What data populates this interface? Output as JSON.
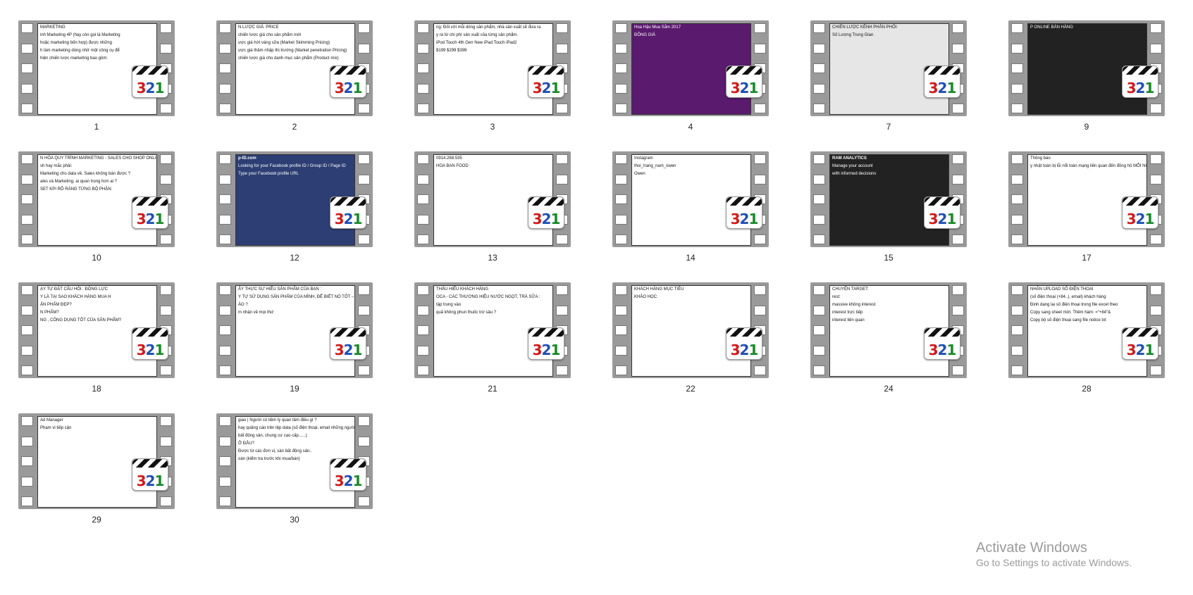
{
  "colors": {
    "film": "#9a9a9a",
    "badge_3": "#d21a1a",
    "badge_2": "#1f4fb8",
    "badge_1": "#1a8a2a"
  },
  "badge_icon": "mpc-321-icon",
  "thumbnails": [
    {
      "label": "1",
      "lines": [
        "MARKETING",
        "inh Marketing 4P (hay còn gọi là Marketing",
        "hoặc marketing bốn hợp) được những",
        "h làm marketing dùng nhử một công cụ để",
        "hiện chiến lược marketing bao gồm:"
      ],
      "style": "light"
    },
    {
      "label": "2",
      "lines": [
        "N LƯỢC GIÁ: PRICE",
        "chiến lược giá cho sản phẩm mới",
        "ược giá hớt váng sữa (Market Skimming Pricing)",
        "ược giá thâm nhập thị trường (Market penetration Pricing)",
        "chiến lược giá cho danh mục sản phẩm (Product mix)"
      ],
      "style": "light"
    },
    {
      "label": "3",
      "lines": [
        "ng: Đối với mỗi dòng sản phẩm, nhà sản xuất sẽ đưa ra",
        "y ra từ chi phí sản xuất của từng sản phẩm.",
        "iPod Touch  4th Gen  New iPad Touch  iPad2",
        "$199   $299   $399"
      ],
      "style": "light"
    },
    {
      "label": "4",
      "lines": [
        "Hoa Hậu Mua Sắm 2017",
        "ĐỒNG GIÁ"
      ],
      "style": "purple"
    },
    {
      "label": "7",
      "lines": [
        "CHIẾN LƯỢC KÊNH PHÂN PHỐI:",
        "Số Lượng Trung Gian"
      ],
      "style": "gray"
    },
    {
      "label": "9",
      "lines": [
        "P ONLINE BÁN HÀNG"
      ],
      "style": "photo"
    },
    {
      "label": "10",
      "lines": [
        "N HÓA QUY TRÌNH MARKETING - SALES CHO SHOP ONLINE",
        "sh hay mắc phải:",
        "Marketing cho data về. Sales không bán được ?",
        "ales và Marketing, ai quan trọng hơn ai ?",
        "SET KPI RÕ RÀNG TỪNG BỘ PHẬN:"
      ],
      "style": "light"
    },
    {
      "label": "12",
      "lines": [
        "p-ID.com",
        "Looking for your Facebook profile ID / Group ID / Page ID",
        "Type your Facebook profile URL"
      ],
      "style": "navy"
    },
    {
      "label": "13",
      "lines": [
        "0914.268.535",
        "HOA BAN FOOD"
      ],
      "style": "web"
    },
    {
      "label": "14",
      "lines": [
        "Instagram",
        "thoi_trang_nam_owen",
        "Owen"
      ],
      "style": "web"
    },
    {
      "label": "15",
      "lines": [
        "RAM ANALYTICS",
        "Manage your account",
        "with informed decisions"
      ],
      "style": "dark"
    },
    {
      "label": "17",
      "lines": [
        "Thông báo",
        "y nhật toán bị lỗi nổi toàn mạng liên quan đến đồng hồ MỖI NGÀY MỘT CÁCH"
      ],
      "style": "light"
    },
    {
      "label": "18",
      "lines": [
        "ẠY TỰ ĐẶT CÂU HỎI : ĐỘNG LỰC",
        "Y LÀ TẠI SAO KHÁCH HÀNG MUA H",
        "ẢN PHẨM ĐẸP?",
        "N PHẨM?",
        "NG , CÔNG DỤNG TỐT CỦA SẢN PHẨM?"
      ],
      "style": "light"
    },
    {
      "label": "19",
      "lines": [
        "ÂY THỰC SỰ HIỂU SẢN PHẨM CỦA BẠN :",
        "Y TỰ SỬ DỤNG SẢN PHẨM CỦA MÌNH, ĐỂ BIẾT NÓ TỐT – KÉM",
        "ÀO ?",
        "m nhận về mọi thứ:"
      ],
      "style": "light"
    },
    {
      "label": "21",
      "lines": [
        "THẤU HIỂU KHÁCH HÀNG",
        "OCA - CÁC THƯƠNG HIỆU NƯỚC NGỌT, TRÀ SỮA :",
        "tập trung vào",
        "quả không phun thuốc trừ sâu ?"
      ],
      "style": "light"
    },
    {
      "label": "22",
      "lines": [
        "KHÁCH HÀNG MỤC TIÊU",
        "KHẢO HỌC:"
      ],
      "style": "light"
    },
    {
      "label": "24",
      "lines": [
        "CHUYỆN TARGET:",
        "rest:",
        "massive không interest",
        "interest trực tiếp",
        "interest liên quan"
      ],
      "style": "light"
    },
    {
      "label": "28",
      "lines": [
        "NHÂN UPLOAD SỐ ĐIỆN THOẠI",
        "(số điện thoại (+84..), email) khách hàng",
        "Định dạng lại số điện thoại trong file excel theo",
        "Copy sang sheet mới. Thêm hàm: =\"+84\"&",
        "Copy bộ số điện thoại sang file notice txt"
      ],
      "style": "light"
    },
    {
      "label": "29",
      "lines": [
        "Ad Manager",
        "Phạm vi tiếp cận"
      ],
      "style": "web"
    },
    {
      "label": "30",
      "lines": [
        "giao | Người có tiềm lý quan tâm điều gì ?",
        "hay quảng cáo trên tệp data (số điện thoại, email những người sở",
        "bất động sản, chung cư cao cấp......)",
        "Ở ĐÂU?",
        "Được từ các đơn vị, sàn bất động sản..",
        "oán (kiểm tra trước khi mua/bán)"
      ],
      "style": "light"
    }
  ],
  "watermark": {
    "title": "Activate Windows",
    "subtitle": "Go to Settings to activate Windows."
  }
}
